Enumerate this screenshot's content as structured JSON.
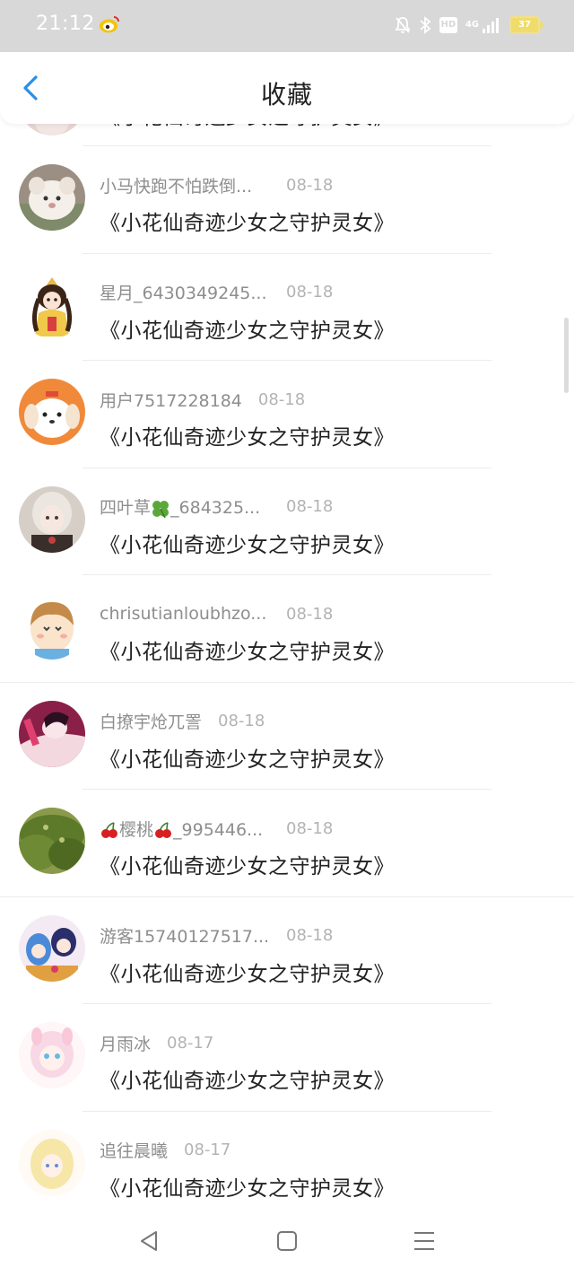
{
  "status_bar": {
    "time": "21:12",
    "network_label": "4G",
    "hd_label": "HD",
    "battery_level": "37",
    "icons": [
      "weibo-icon",
      "bell-mute-icon",
      "bluetooth-icon",
      "hd-icon",
      "signal-icon",
      "battery-icon"
    ]
  },
  "header": {
    "title": "收藏",
    "back_icon": "chevron-left-icon",
    "accent_color": "#2a8fe6"
  },
  "items": [
    {
      "name": "",
      "date": "",
      "title": "《小花仙奇迹少女之守护灵女》",
      "avatar": "partial-avatar"
    },
    {
      "name": "小马快跑不怕跌倒...",
      "date": "08-18",
      "title": "《小花仙奇迹少女之守护灵女》",
      "avatar": "fluffy-animal-avatar"
    },
    {
      "name": "星月_6430349245...",
      "date": "08-18",
      "title": "《小花仙奇迹少女之守护灵女》",
      "avatar": "anime-girl-avatar"
    },
    {
      "name": "用户7517228184",
      "date": "08-18",
      "title": "《小花仙奇迹少女之守护灵女》",
      "avatar": "dog-avatar"
    },
    {
      "name_prefix": "四叶草",
      "name_suffix": "_684325...",
      "date": "08-18",
      "title": "《小花仙奇迹少女之守护灵女》",
      "avatar": "doll-avatar"
    },
    {
      "name": "chrisutianloubhzo...",
      "date": "08-18",
      "title": "《小花仙奇迹少女之守护灵女》",
      "avatar": "cartoon-boy-avatar"
    },
    {
      "name": "白撩宇炝兀詈",
      "date": "08-18",
      "title": "《小花仙奇迹少女之守护灵女》",
      "avatar": "anime-character-avatar"
    },
    {
      "name_prefix": "樱桃",
      "name_suffix": "_995446...",
      "date": "08-18",
      "title": "《小花仙奇迹少女之守护灵女》",
      "avatar": "grass-field-avatar"
    },
    {
      "name": "游客15740127517...",
      "date": "08-18",
      "title": "《小花仙奇迹少女之守护灵女》",
      "avatar": "anime-group-avatar"
    },
    {
      "name": "月雨冰",
      "date": "08-17",
      "title": "《小花仙奇迹少女之守护灵女》",
      "avatar": "pink-anime-avatar"
    },
    {
      "name": "追往晨曦",
      "date": "08-17",
      "title": "《小花仙奇迹少女之守护灵女》",
      "avatar": "blonde-anime-avatar"
    }
  ],
  "nav": {
    "back_icon": "triangle-back-icon",
    "home_icon": "square-home-icon",
    "menu_icon": "menu-lines-icon"
  }
}
